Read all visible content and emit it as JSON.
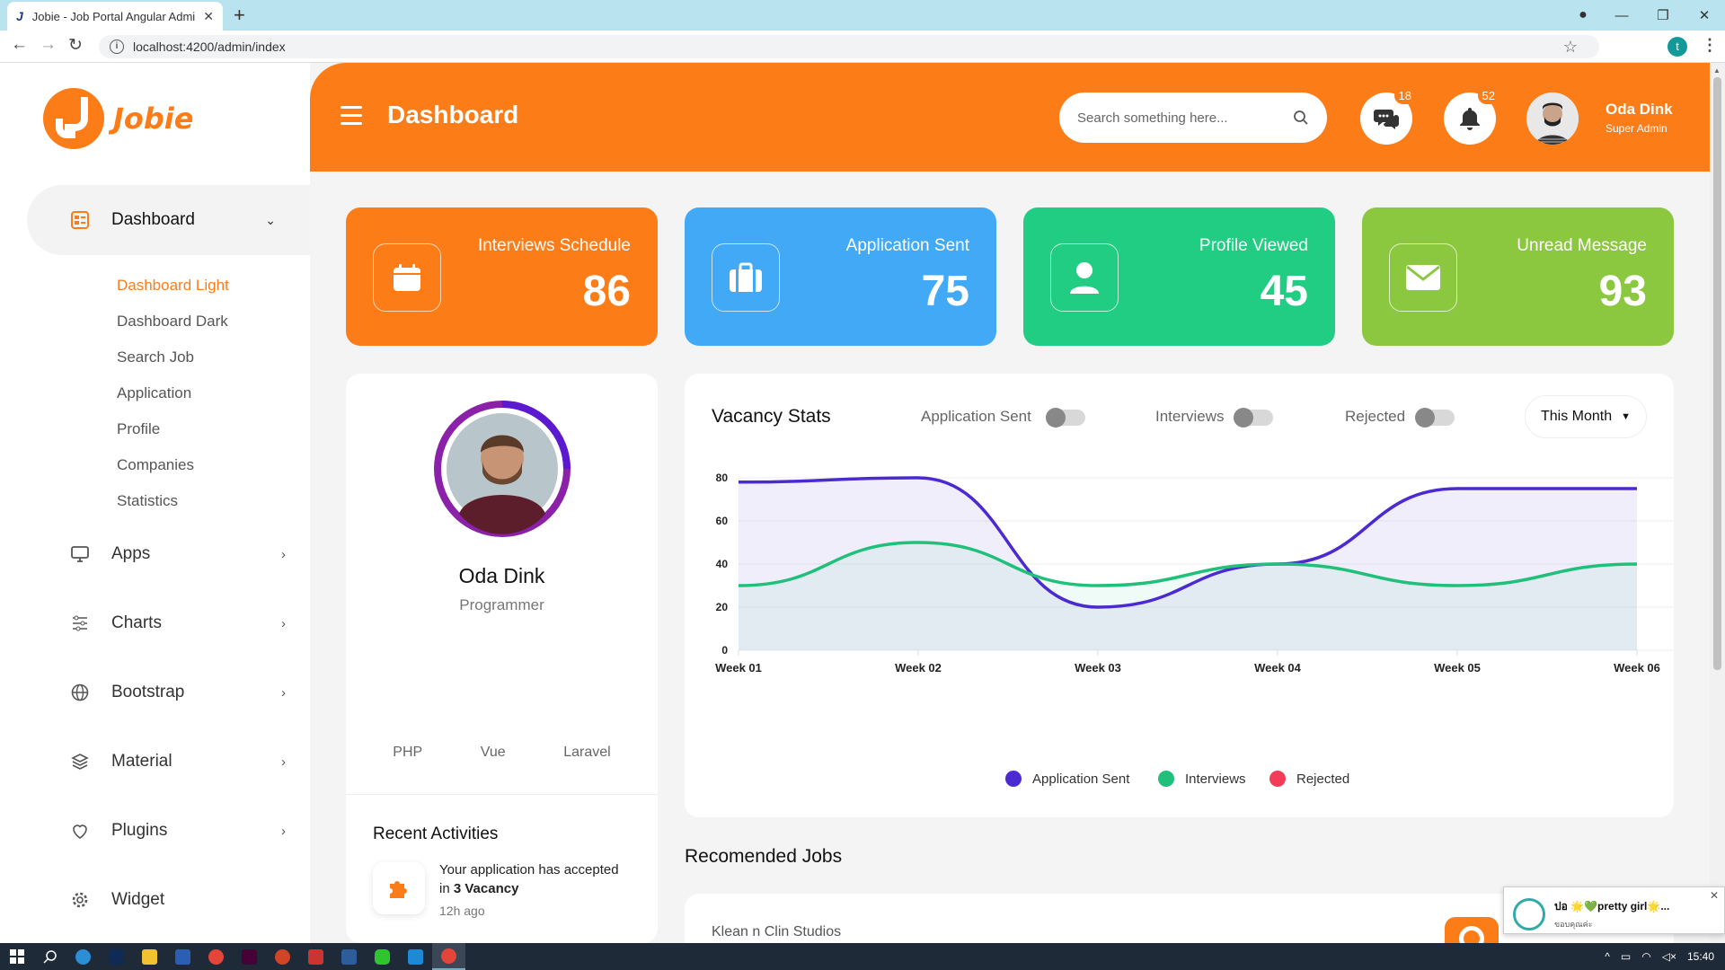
{
  "browser": {
    "tab_title": "Jobie - Job Portal Angular Admin",
    "tab_icon": "J",
    "url": "localhost:4200/admin/index",
    "profile_initial": "t"
  },
  "sidebar": {
    "logo_text": "Jobie",
    "active_item": "Dashboard",
    "subitems": [
      "Dashboard Light",
      "Dashboard Dark",
      "Search Job",
      "Application",
      "Profile",
      "Companies",
      "Statistics"
    ],
    "items": [
      {
        "label": "Apps",
        "icon": "monitor-icon"
      },
      {
        "label": "Charts",
        "icon": "sliders-icon"
      },
      {
        "label": "Bootstrap",
        "icon": "globe-icon"
      },
      {
        "label": "Material",
        "icon": "layers-icon"
      },
      {
        "label": "Plugins",
        "icon": "heart-icon"
      },
      {
        "label": "Widget",
        "icon": "gear-icon"
      }
    ]
  },
  "header": {
    "title": "Dashboard",
    "search_placeholder": "Search something here...",
    "messages_count": "18",
    "notifications_count": "52",
    "user_name": "Oda Dink",
    "user_role": "Super Admin"
  },
  "stats": [
    {
      "label": "Interviews Schedule",
      "value": "86",
      "color": "#fc7c18",
      "icon": "calendar-icon"
    },
    {
      "label": "Application Sent",
      "value": "75",
      "color": "#41a9f6",
      "icon": "briefcase-icon"
    },
    {
      "label": "Profile Viewed",
      "value": "45",
      "color": "#21cd82",
      "icon": "user-icon"
    },
    {
      "label": "Unread Message",
      "value": "93",
      "color": "#8bc840",
      "icon": "envelope-icon"
    }
  ],
  "profile": {
    "name": "Oda Dink",
    "role": "Programmer",
    "skills": [
      "PHP",
      "Vue",
      "Laravel"
    ],
    "recent_title": "Recent Activities",
    "activity_text": "Your application has accepted in",
    "activity_bold": "3 Vacancy",
    "activity_time": "12h ago"
  },
  "vacancy": {
    "title": "Vacancy Stats",
    "toggles": [
      "Application Sent",
      "Interviews",
      "Rejected"
    ],
    "period": "This Month"
  },
  "chart_data": {
    "type": "area",
    "x": [
      "Week 01",
      "Week 02",
      "Week 03",
      "Week 04",
      "Week 05",
      "Week 06"
    ],
    "ylim": [
      0,
      80
    ],
    "yticks": [
      0,
      20,
      40,
      60,
      80
    ],
    "series": [
      {
        "name": "Application Sent",
        "color": "#4b2bd1",
        "values": [
          78,
          80,
          20,
          40,
          75,
          75
        ]
      },
      {
        "name": "Interviews",
        "color": "#21c07a",
        "values": [
          30,
          50,
          30,
          40,
          30,
          40
        ]
      },
      {
        "name": "Rejected",
        "color": "#f43b57",
        "values": []
      }
    ],
    "legend_position": "bottom"
  },
  "jobs": {
    "title": "Recomended Jobs",
    "first_company": "Klean n Clin Studios"
  },
  "notification": {
    "title": "ปอ 🌟💚pretty girl🌟...",
    "subtitle": "ขอบคุณค่ะ"
  },
  "taskbar": {
    "time": "15:40"
  }
}
